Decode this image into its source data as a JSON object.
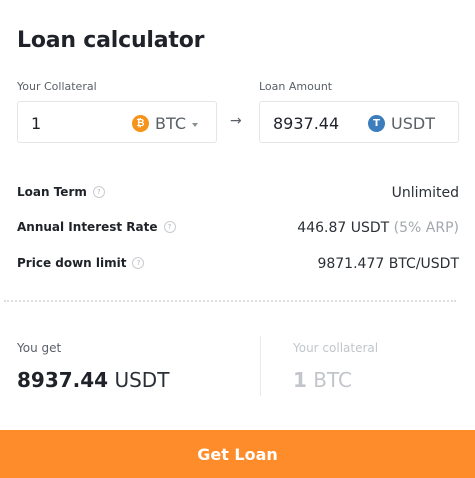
{
  "title": "Loan calculator",
  "collateral": {
    "label": "Your Collateral",
    "value": "1",
    "currency": "BTC",
    "currency_icon": "bitcoin-icon",
    "currency_icon_glyph": "₿"
  },
  "arrow": "→",
  "loan": {
    "label": "Loan Amount",
    "value": "8937.44",
    "currency": "USDT",
    "currency_icon": "tether-icon",
    "currency_icon_glyph": "T"
  },
  "details": {
    "term": {
      "label": "Loan Term",
      "value": "Unlimited"
    },
    "rate": {
      "label": "Annual Interest Rate",
      "value": "446.87 USDT",
      "sub": "(5% ARP)"
    },
    "limit": {
      "label": "Price down limit",
      "value": "9871.477 BTC/USDT"
    },
    "info_glyph": "?"
  },
  "summary": {
    "get_label": "You get",
    "get_value": "8937.44",
    "get_unit": "USDT",
    "collateral_label": "Your collateral",
    "collateral_value": "1",
    "collateral_unit": "BTC"
  },
  "cta": {
    "label": "Get Loan"
  },
  "colors": {
    "accent": "#ff8c2a",
    "btc": "#f7931a",
    "usdt": "#3c7dbd",
    "muted": "#c2c6ca"
  }
}
